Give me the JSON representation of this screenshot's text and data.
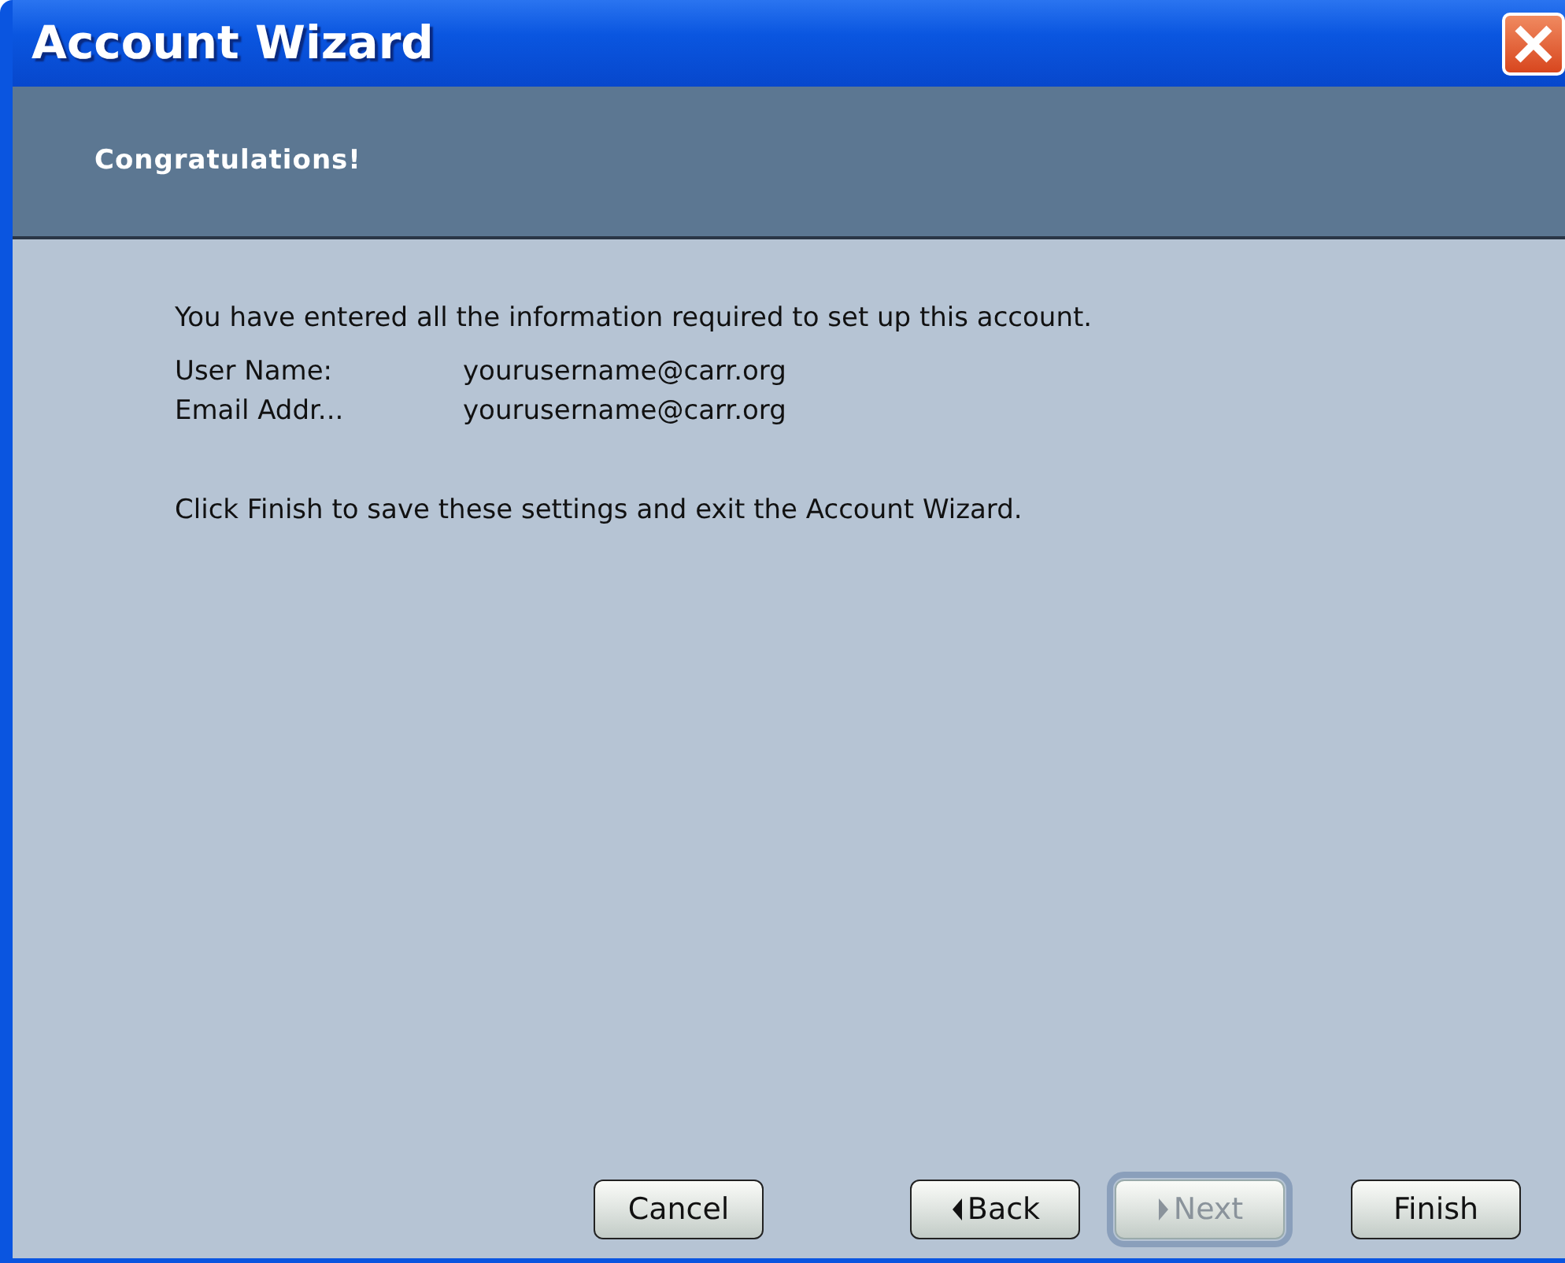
{
  "window": {
    "title": "Account Wizard"
  },
  "header": {
    "title": "Congratulations!"
  },
  "intro": "You have entered all the information required to set up this account.",
  "fields": [
    {
      "label": "User Name:",
      "value": "yourusername@carr.org"
    },
    {
      "label": "Email Addr...",
      "value": "yourusername@carr.org"
    }
  ],
  "outro": "Click Finish to save these settings and exit the Account Wizard.",
  "buttons": [
    {
      "label": "Cancel",
      "kind": "plain",
      "disabled": false,
      "focused": false
    },
    {
      "label": "Back",
      "kind": "back",
      "disabled": false,
      "focused": false
    },
    {
      "label": "Next",
      "kind": "next",
      "disabled": true,
      "focused": true
    },
    {
      "label": "Finish",
      "kind": "plain",
      "disabled": false,
      "focused": false
    }
  ]
}
